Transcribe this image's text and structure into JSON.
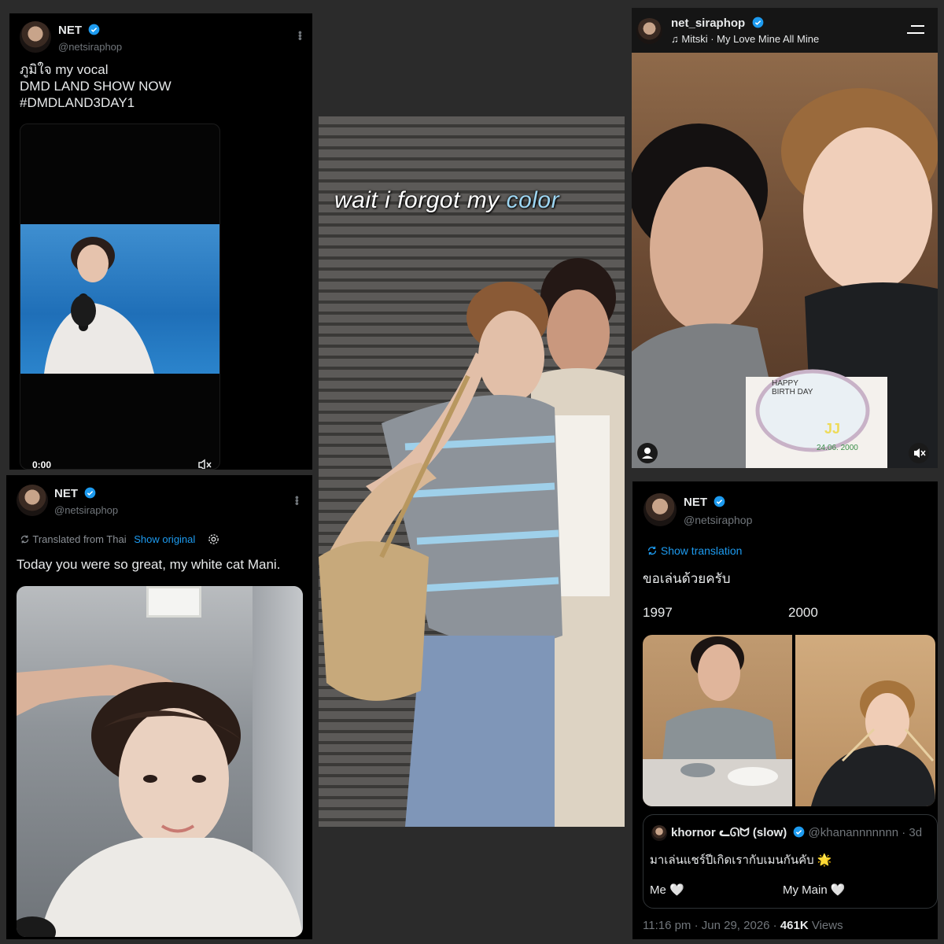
{
  "panel1": {
    "name": "NET",
    "handle": "@netsiraphop",
    "text_line1": "ภูมิใจ my vocal",
    "text_line2": "DMD LAND SHOW NOW",
    "hashtag": "#DMDLAND3DAY1",
    "video_time": "0:00"
  },
  "panel2": {
    "caption_prefix": "wait i forgot my ",
    "caption_color_word": "color"
  },
  "panel3": {
    "username": "net_siraphop",
    "music": "Mitski · My Love Mine All Mine",
    "cake_text1": "HAPPY BIRTH DAY",
    "cake_text2": "JJ",
    "cake_text3": "24.06. 2000"
  },
  "panel4": {
    "name": "NET",
    "handle": "@netsiraphop",
    "translated_label": "Translated from Thai",
    "show_original": "Show original",
    "text": "Today you were so great, my white cat Mani."
  },
  "panel5": {
    "name": "NET",
    "handle": "@netsiraphop",
    "show_translation": "Show translation",
    "text": "ขอเล่นด้วยครับ",
    "year_left": "1997",
    "year_right": "2000",
    "quote_name": "khornor ᓚᘏᗢ (slow)",
    "quote_handle": "@khanannnnnnn",
    "quote_age": "· 3d",
    "quote_text": "มาเล่นแชร์ปีเกิดเรากับเมนกันคับ 🌟",
    "quote_me": "Me 🤍",
    "quote_main": "My Main 🤍",
    "timestamp": "11:16 pm · Jun 29, 2026 · ",
    "views_count": "461K",
    "views_label": " Views"
  }
}
